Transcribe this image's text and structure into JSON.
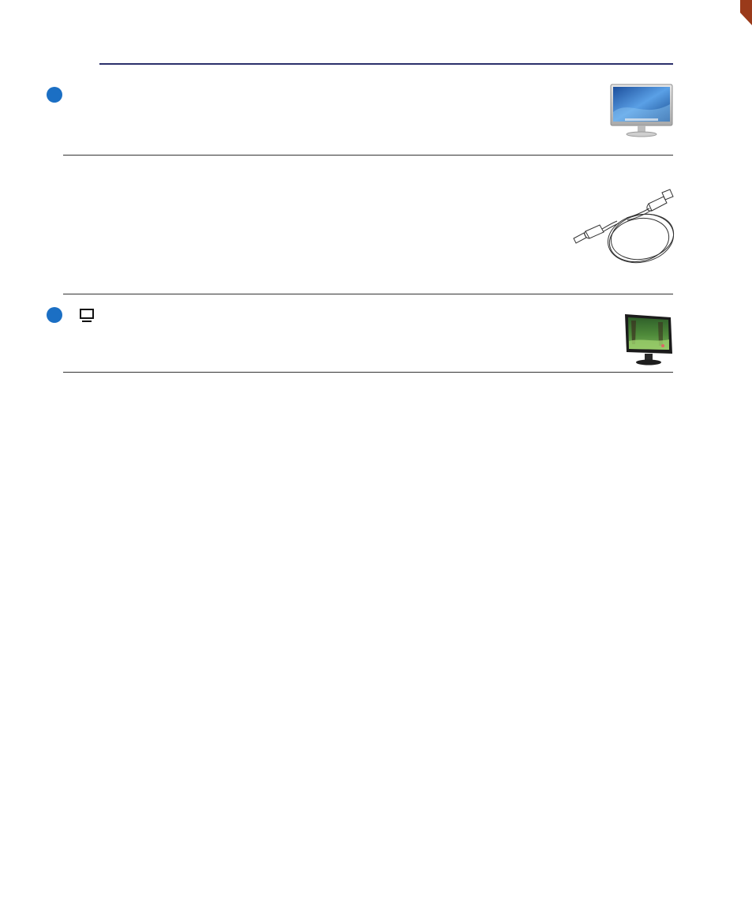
{
  "header": {
    "rule_color": "#2b2f6b",
    "corner_mark_color": "#9a3a1a"
  },
  "sections": [
    {
      "bullet_color": "#1b6fc4",
      "image": "widescreen-monitor"
    },
    {
      "image": "hdmi-cable"
    },
    {
      "bullet_color": "#1b6fc4",
      "inline_icon": "display-icon",
      "image": "lcd-monitor"
    }
  ]
}
